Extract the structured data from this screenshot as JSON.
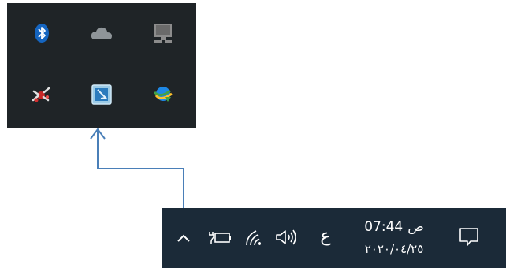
{
  "tray_flyout": {
    "icons": [
      {
        "name": "bluetooth-icon"
      },
      {
        "name": "onedrive-cloud-icon"
      },
      {
        "name": "network-drive-icon"
      },
      {
        "name": "satellite-app-icon"
      },
      {
        "name": "app-launcher-icon"
      },
      {
        "name": "download-manager-icon"
      }
    ]
  },
  "taskbar": {
    "icons": {
      "show_hidden": "chevron-up-icon",
      "power": "battery-plug-icon",
      "network": "wifi-icon",
      "volume": "speaker-icon",
      "notifications": "action-center-icon"
    },
    "language_indicator": "ع",
    "clock": {
      "ampm": "ص",
      "time": "07:44",
      "date": "٢٠٢٠/٠٤/٢٥"
    }
  },
  "colors": {
    "flyout_bg": "#1f2427",
    "taskbar_bg": "#1b2a38",
    "arrow": "#4a7fb8"
  }
}
